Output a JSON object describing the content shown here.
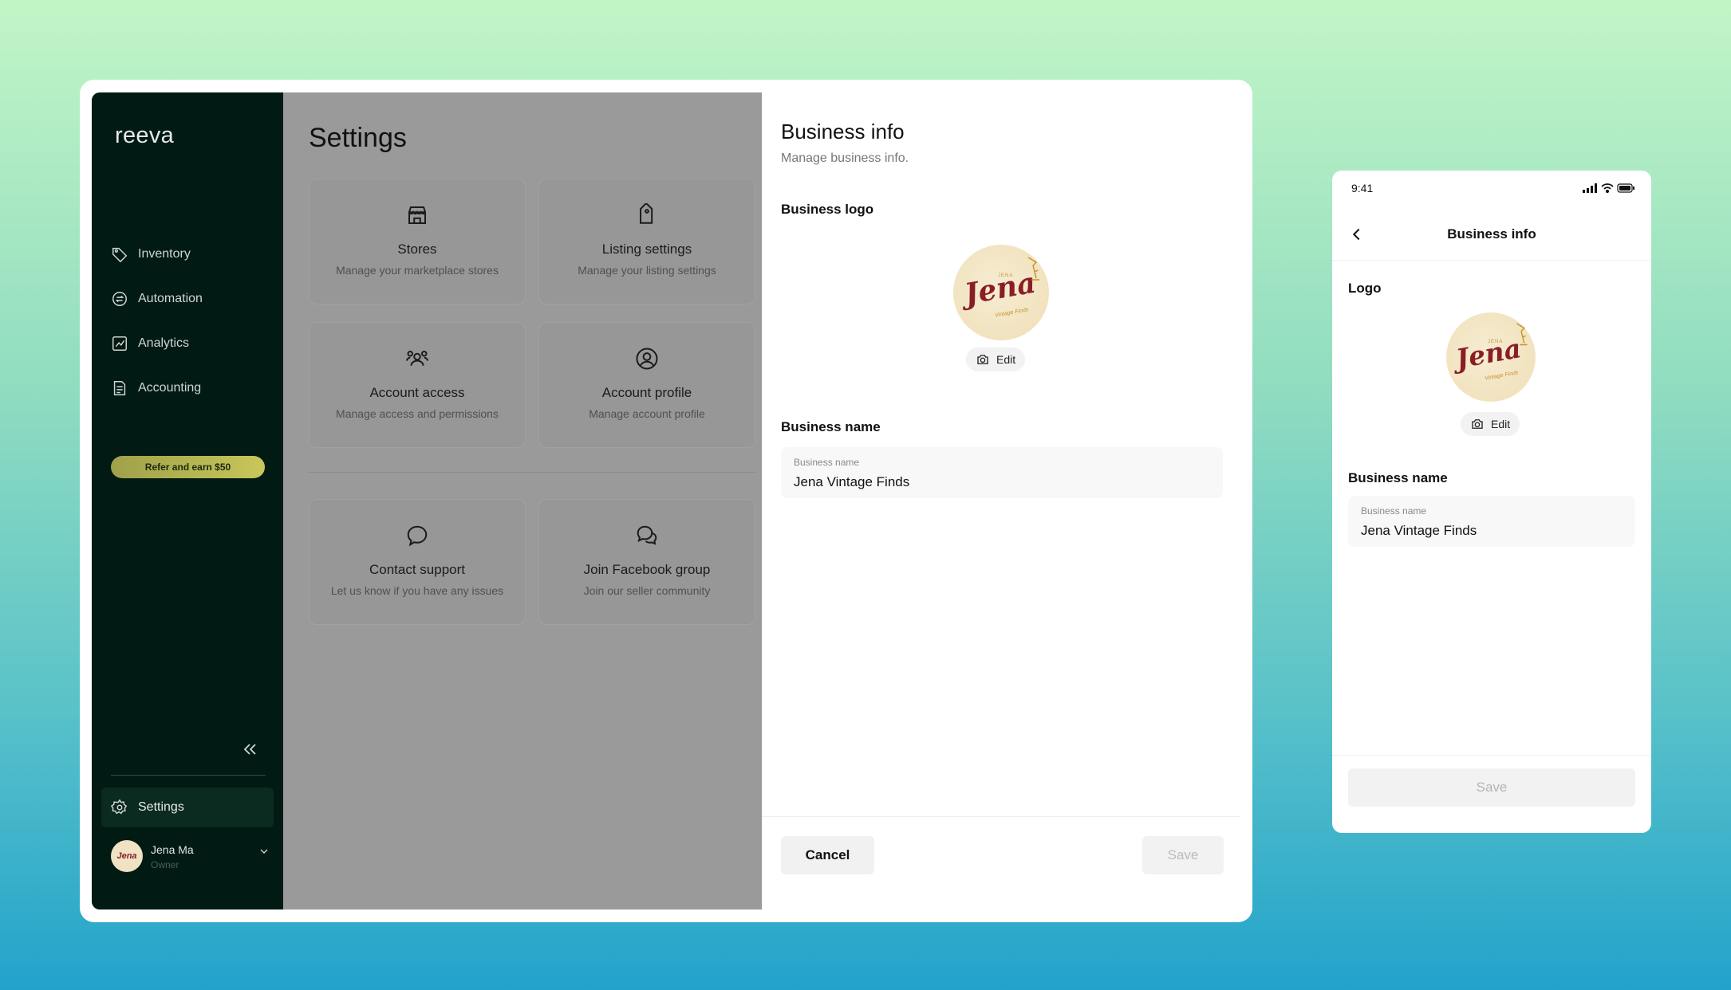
{
  "desktop": {
    "sidebar": {
      "brand": "reeva",
      "items": [
        {
          "label": "Inventory",
          "icon": "tag-icon"
        },
        {
          "label": "Automation",
          "icon": "automation-icon"
        },
        {
          "label": "Analytics",
          "icon": "analytics-icon"
        },
        {
          "label": "Accounting",
          "icon": "document-icon"
        }
      ],
      "refer_label": "Refer and earn $50",
      "settings_label": "Settings",
      "user": {
        "name": "Jena Ma",
        "role": "Owner"
      }
    },
    "settings": {
      "title": "Settings",
      "cards": [
        {
          "title": "Stores",
          "subtitle": "Manage your marketplace stores",
          "icon": "store-icon"
        },
        {
          "title": "Listing settings",
          "subtitle": "Manage your listing settings",
          "icon": "tag-icon"
        },
        {
          "title": "Account access",
          "subtitle": "Manage access and permissions",
          "icon": "users-icon"
        },
        {
          "title": "Account profile",
          "subtitle": "Manage account profile",
          "icon": "user-circle-icon"
        },
        {
          "title": "Contact support",
          "subtitle": "Let us know if you have any issues",
          "icon": "chat-bubble-icon"
        },
        {
          "title": "Join Facebook group",
          "subtitle": "Join our seller community",
          "icon": "chat-group-icon"
        }
      ]
    },
    "business_info": {
      "title": "Business info",
      "subtitle": "Manage business info.",
      "logo_label": "Business logo",
      "logo_text": "Jena",
      "logo_top": "JENA",
      "logo_sub": "Vintage Finds",
      "edit_label": "Edit",
      "name_label": "Business name",
      "field_label": "Business name",
      "field_value": "Jena Vintage Finds",
      "cancel_label": "Cancel",
      "save_label": "Save"
    }
  },
  "mobile": {
    "time": "9:41",
    "title": "Business info",
    "logo_label": "Logo",
    "logo_text": "Jena",
    "logo_top": "JENA",
    "logo_sub": "Vintage Finds",
    "edit_label": "Edit",
    "name_label": "Business name",
    "field_label": "Business name",
    "field_value": "Jena Vintage Finds",
    "save_label": "Save"
  },
  "colors": {
    "sidebar_bg": "#011a14",
    "logo_red": "#8a1e26",
    "refer_badge": "#b3b352",
    "overlay_gray": "#9a9a9a"
  }
}
